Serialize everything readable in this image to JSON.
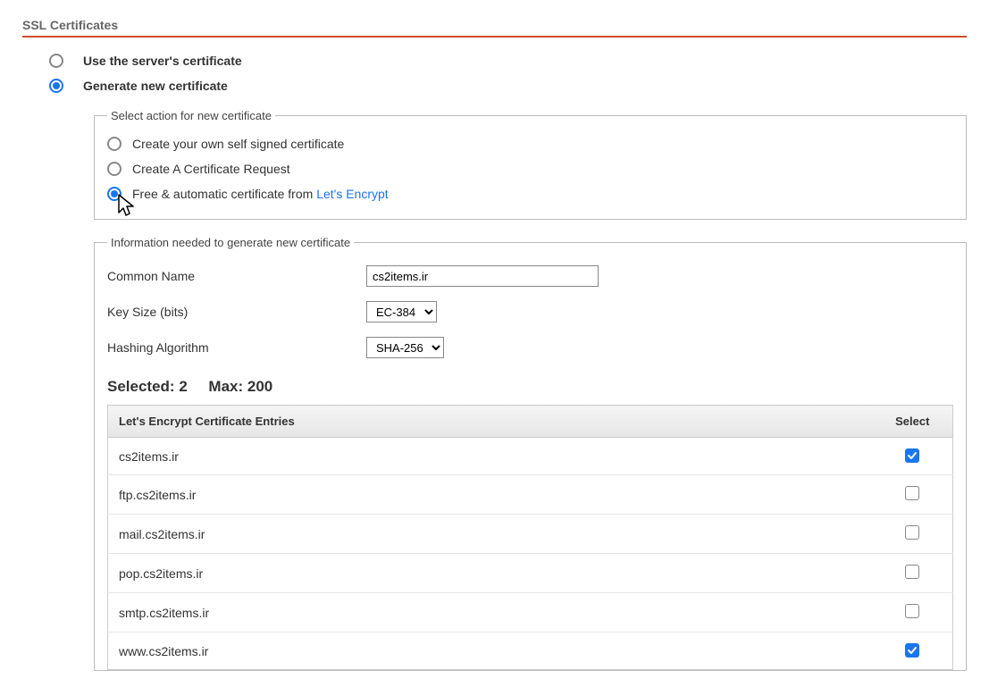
{
  "section_title": "SSL Certificates",
  "main_options": {
    "use_server": {
      "label": "Use the server's certificate",
      "selected": false
    },
    "generate_new": {
      "label": "Generate new certificate",
      "selected": true
    }
  },
  "action_group": {
    "legend": "Select action for new certificate",
    "options": {
      "self_signed": {
        "label": "Create your own self signed certificate",
        "selected": false
      },
      "csr": {
        "label": "Create A Certificate Request",
        "selected": false
      },
      "letsencrypt": {
        "prefix": "Free & automatic certificate from ",
        "link_text": "Let's Encrypt",
        "selected": true
      }
    }
  },
  "info_group": {
    "legend": "Information needed to generate new certificate",
    "common_name": {
      "label": "Common Name",
      "value": "cs2items.ir"
    },
    "key_size": {
      "label": "Key Size (bits)",
      "value": "EC-384"
    },
    "hashing": {
      "label": "Hashing Algorithm",
      "value": "SHA-256"
    },
    "selected_count": 2,
    "max_count": 200,
    "selected_prefix": "Selected: ",
    "max_prefix": "Max: ",
    "table": {
      "header_name": "Let's Encrypt Certificate Entries",
      "header_select": "Select",
      "rows": [
        {
          "name": "cs2items.ir",
          "checked": true
        },
        {
          "name": "ftp.cs2items.ir",
          "checked": false
        },
        {
          "name": "mail.cs2items.ir",
          "checked": false
        },
        {
          "name": "pop.cs2items.ir",
          "checked": false
        },
        {
          "name": "smtp.cs2items.ir",
          "checked": false
        },
        {
          "name": "www.cs2items.ir",
          "checked": true
        }
      ]
    }
  }
}
